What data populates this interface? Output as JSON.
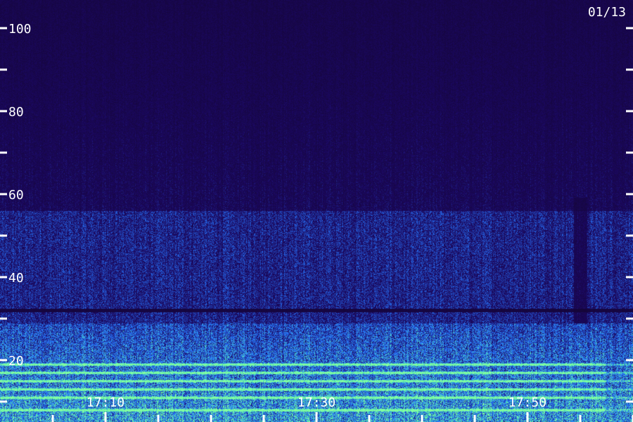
{
  "date_label": "01/13",
  "chart_data": {
    "type": "heatmap",
    "y_ticks": [
      20,
      40,
      60,
      80,
      100
    ],
    "ylim": [
      5,
      106
    ],
    "x_ticks": [
      "17:10",
      "17:30",
      "17:50"
    ],
    "x_tick_minutes": [
      10,
      30,
      50
    ],
    "xlim_minutes": [
      1,
      61
    ],
    "minor_x_tick_minutes": [
      5,
      15,
      20,
      25,
      35,
      40,
      45,
      55,
      60
    ],
    "bands": [
      {
        "y": 32,
        "kind": "dark-line"
      },
      {
        "y": 19,
        "kind": "bright-line"
      },
      {
        "y": 17,
        "kind": "bright-line"
      },
      {
        "y": 15,
        "kind": "bright-line"
      },
      {
        "y": 13,
        "kind": "bright-line"
      },
      {
        "y": 11,
        "kind": "bright-line"
      },
      {
        "y": 8,
        "kind": "bright-line"
      }
    ],
    "grid": false,
    "colors": {
      "background": "#14093a",
      "low": "#1a0a4a",
      "mid": "#2020c0",
      "high": "#3c7cff",
      "peak": "#7cff9c",
      "axis": "#ffffff"
    }
  }
}
